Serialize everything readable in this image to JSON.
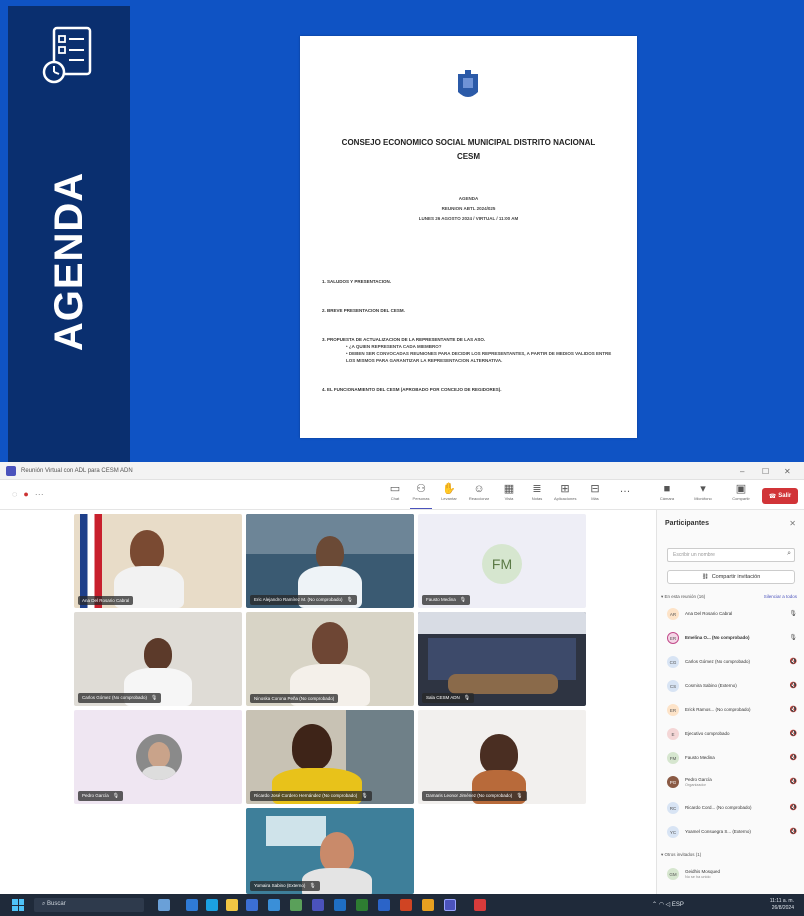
{
  "slide": {
    "side_title": "AGENDA",
    "doc": {
      "header": "",
      "seal_caption": "",
      "title": "CONSEJO ECONOMICO SOCIAL MUNICIPAL DISTRITO NACIONAL",
      "subtitle": "CESM",
      "meta": [
        "AGENDA",
        "REUNION ABTL 2024/025",
        "LUNES 26 AGOSTO 2024 / VIRTUAL / 11:00 AM"
      ],
      "items": [
        {
          "text": "1.  SALUDOS Y PRESENTACION.",
          "subs": []
        },
        {
          "text": "2.  BREVE PRESENTACION DEL CESM.",
          "subs": []
        },
        {
          "text": "3.  PROPUESTA DE ACTUALIZACION DE LA REPRESENTANTE DE LAS ASO.",
          "subs": [
            "•  ¿A QUIEN REPRESENTA CADA MIEMBRO?",
            "•  DEBEN SER CONVOCADAS REUNIONES PARA DECIDIR LOS REPRESENTANTES, A PARTIR DE MEDIOS VALIDOS ENTRE LOS MISMOS PARA GARANTIZAR LA REPRESENTACION ALTERNATIVA."
          ]
        },
        {
          "text": "4.  EL FUNCIONAMIENTO DEL CESM (APROBADO POR CONCEJO DE REGIDORES).",
          "subs": []
        }
      ]
    }
  },
  "window": {
    "title": "Reunión Virtual con ADL para CESM ADN"
  },
  "toolbar": {
    "buttons": [
      {
        "id": "chat",
        "icon": "chat-icon",
        "label": "Chat"
      },
      {
        "id": "people",
        "icon": "people-icon",
        "label": "Personas"
      },
      {
        "id": "raise",
        "icon": "hand-icon",
        "label": "Levantar"
      },
      {
        "id": "react",
        "icon": "smile-icon",
        "label": "Reaccionar"
      },
      {
        "id": "view",
        "icon": "grid-icon",
        "label": "Vista"
      },
      {
        "id": "notes",
        "icon": "notes-icon",
        "label": "Notas"
      },
      {
        "id": "apps",
        "icon": "apps-icon",
        "label": "Aplicaciones"
      },
      {
        "id": "more",
        "icon": "more-icon",
        "label": "Más"
      },
      {
        "id": "camera",
        "icon": "camera-icon",
        "label": "Cámara"
      },
      {
        "id": "mic",
        "icon": "mic-icon",
        "label": "Micrófono"
      },
      {
        "id": "share",
        "icon": "share-icon",
        "label": "Compartir"
      }
    ],
    "leave_label": "Salir"
  },
  "tiles": [
    {
      "name": "Ana Del Rosario Cabral"
    },
    {
      "name": "Eric Alejandro Ramírez M. (No comprobado)"
    },
    {
      "name": "Fausto Medina",
      "initials": "FM"
    },
    {
      "name": "Carlos Gómez (No comprobado)"
    },
    {
      "name": "Ninoska Corona Peña (No comprobado)"
    },
    {
      "name": "Sala CESM ADN"
    },
    {
      "name": "Pedro García"
    },
    {
      "name": "Ricardo José Cordero Hernández (No comprobado)"
    },
    {
      "name": "Damaris Leonor Jiménez (No comprobado)"
    },
    {
      "name": "Yomaira Sabino (Externo)"
    }
  ],
  "panel": {
    "title": "Participantes",
    "search_placeholder": "Escribir un nombre",
    "share_invite": "Compartir invitación",
    "section_title": "En esta reunión (16)",
    "mute_all": "Silenciar a todos",
    "participants": [
      {
        "initials": "AR",
        "name": "Ana Del Rosario Cabral",
        "sub": ""
      },
      {
        "initials": "ER",
        "name": "Emelina O... (No comprobado)",
        "sub": ""
      },
      {
        "initials": "CG",
        "name": "Carlos Gómez (No comprobado)",
        "sub": ""
      },
      {
        "initials": "CS",
        "name": "Cosmira Sabino (Externo)",
        "sub": ""
      },
      {
        "initials": "ER",
        "name": "Erick Ramos... (No comprobado)",
        "sub": ""
      },
      {
        "initials": "E",
        "name": "Ejecutivo comprobado",
        "sub": ""
      },
      {
        "initials": "FM",
        "name": "Fausto Medina",
        "sub": ""
      },
      {
        "initials": "PG",
        "name": "Pedro García",
        "sub": "Organizador"
      },
      {
        "initials": "RC",
        "name": "Ricardo Cord... (No comprobado)",
        "sub": ""
      },
      {
        "initials": "YC",
        "name": "Yoamel Consuegra S... (Externo)",
        "sub": ""
      }
    ],
    "section2_title": "Otros invitados (1)",
    "invited": {
      "initials": "GM",
      "name": "Geidhis Mosqued",
      "sub": "No se ha unido"
    }
  },
  "taskbar": {
    "search": "Buscar",
    "time": "11:11 a. m.",
    "date": "26/8/2024",
    "tray": "ESP"
  }
}
